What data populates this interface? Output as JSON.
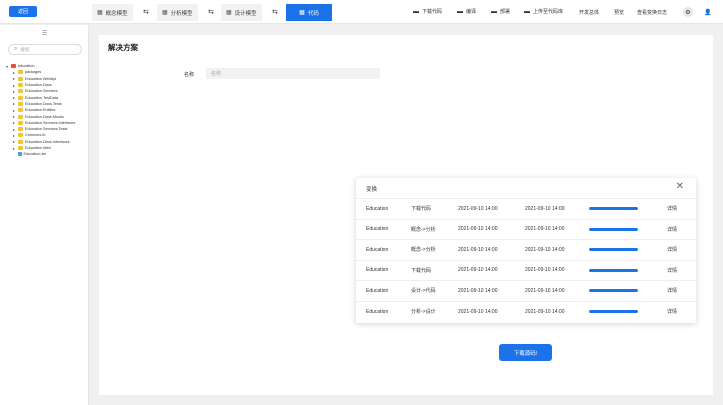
{
  "topbar": {
    "back_label": "返回",
    "tabs": [
      {
        "label": "概念模型",
        "active": false
      },
      {
        "label": "分析模型",
        "active": false
      },
      {
        "label": "设计模型",
        "active": false
      },
      {
        "label": "代码",
        "active": true
      }
    ],
    "tools": [
      {
        "label": "下载代码",
        "icon": "folder-icon"
      },
      {
        "label": "编译",
        "icon": "folder-icon"
      },
      {
        "label": "部署",
        "icon": "folder-icon"
      },
      {
        "label": "上传至代码库",
        "icon": "folder-icon"
      }
    ],
    "plain_tools": [
      "开发总体",
      "预览",
      "查看变换日志"
    ]
  },
  "sidebar": {
    "search_placeholder": "搜索",
    "tree": [
      {
        "label": "education",
        "depth": 0,
        "type": "folder-red",
        "expanded": true
      },
      {
        "label": "packages",
        "depth": 1,
        "type": "folder"
      },
      {
        "label": "Education.WebApi",
        "depth": 1,
        "type": "folder"
      },
      {
        "label": "Education.Daos",
        "depth": 1,
        "type": "folder"
      },
      {
        "label": "Education.Services",
        "depth": 1,
        "type": "folder"
      },
      {
        "label": "Education.TestData",
        "depth": 1,
        "type": "folder"
      },
      {
        "label": "Education.Daos.Tests",
        "depth": 1,
        "type": "folder"
      },
      {
        "label": "Education.Entities",
        "depth": 1,
        "type": "folder"
      },
      {
        "label": "Education.Daos.Mocks",
        "depth": 1,
        "type": "folder"
      },
      {
        "label": "Education.Services.Interfaces",
        "depth": 1,
        "type": "folder"
      },
      {
        "label": "Education.Services.Tests",
        "depth": 1,
        "type": "folder"
      },
      {
        "label": "CommonLib",
        "depth": 1,
        "type": "folder"
      },
      {
        "label": "Education.Daos.Interfaces",
        "depth": 1,
        "type": "folder"
      },
      {
        "label": "Education.Web",
        "depth": 1,
        "type": "folder"
      },
      {
        "label": "Education.sln",
        "depth": 1,
        "type": "file"
      }
    ]
  },
  "main": {
    "title": "解决方案",
    "name_label": "名称",
    "name_placeholder": "名称",
    "download_button": "下载源码!"
  },
  "dialog": {
    "title": "变换",
    "close_glyph": "✕",
    "rows": [
      {
        "project": "Education",
        "operation": "下载代码",
        "start": "2021-09-10  14:00",
        "end": "2021-09-10  14:00",
        "progress": 1.0,
        "detail": "详情"
      },
      {
        "project": "Education",
        "operation": "概念->分析",
        "start": "2021-09-10  14:00",
        "end": "2021-09-10  14:00",
        "progress": 1.0,
        "detail": "详情"
      },
      {
        "project": "Education",
        "operation": "概念->分析",
        "start": "2021-09-10  14:00",
        "end": "2021-09-10  14:00",
        "progress": 1.0,
        "detail": "详情"
      },
      {
        "project": "Education",
        "operation": "下载代码",
        "start": "2021-09-10  14:00",
        "end": "2021-09-10  14:00",
        "progress": 1.0,
        "detail": "详情"
      },
      {
        "project": "Education",
        "operation": "设计->代码",
        "start": "2021-09-10  14:00",
        "end": "2021-09-10  14:00",
        "progress": 1.0,
        "detail": "详情"
      },
      {
        "project": "Education",
        "operation": "分析->设计",
        "start": "2021-09-10  14:00",
        "end": "2021-09-10  14:00",
        "progress": 1.0,
        "detail": "详情"
      }
    ]
  },
  "colors": {
    "accent": "#1a73e8"
  }
}
